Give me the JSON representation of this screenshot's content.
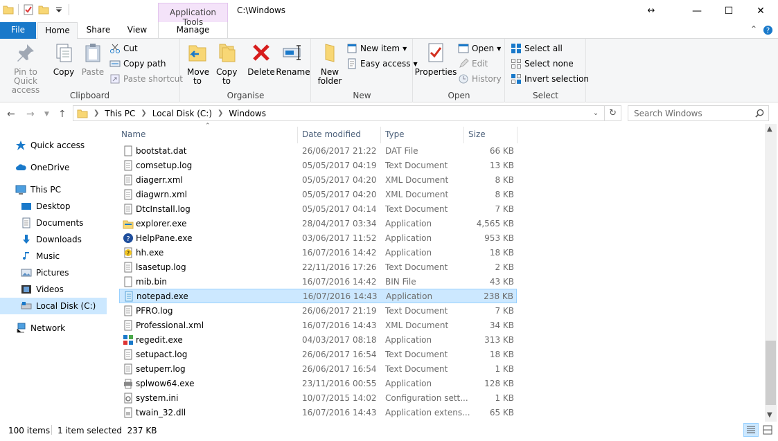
{
  "window": {
    "title": "C:\\Windows",
    "context_tab_group": "Application Tools",
    "minimize": "—",
    "maximize": "☐",
    "close": "✕",
    "resize_glyph": "↔"
  },
  "ribbon_tabs": {
    "file": "File",
    "home": "Home",
    "share": "Share",
    "view": "View",
    "manage": "Manage"
  },
  "ribbon": {
    "clipboard": {
      "label": "Clipboard",
      "pin_label": "Pin to Quick access",
      "copy_label": "Copy",
      "paste_label": "Paste",
      "cut_label": "Cut",
      "copy_path_label": "Copy path",
      "paste_shortcut_label": "Paste shortcut"
    },
    "organise": {
      "label": "Organise",
      "move_label": "Move to",
      "copy_to_label": "Copy to",
      "delete_label": "Delete",
      "rename_label": "Rename"
    },
    "new": {
      "label": "New",
      "new_folder_label": "New folder",
      "new_item_label": "New item",
      "easy_access_label": "Easy access"
    },
    "open": {
      "label": "Open",
      "properties_label": "Properties",
      "open_label": "Open",
      "edit_label": "Edit",
      "history_label": "History"
    },
    "select": {
      "label": "Select",
      "select_all_label": "Select all",
      "select_none_label": "Select none",
      "invert_label": "Invert selection"
    }
  },
  "address": {
    "crumbs": [
      "This PC",
      "Local Disk (C:)",
      "Windows"
    ],
    "search_placeholder": "Search Windows"
  },
  "nav_pane": {
    "items": [
      {
        "label": "Quick access",
        "icon": "star-icon"
      },
      {
        "label": "OneDrive",
        "icon": "cloud-icon"
      },
      {
        "label": "This PC",
        "icon": "computer-icon"
      },
      {
        "label": "Desktop",
        "icon": "desktop-icon"
      },
      {
        "label": "Documents",
        "icon": "documents-icon"
      },
      {
        "label": "Downloads",
        "icon": "download-icon"
      },
      {
        "label": "Music",
        "icon": "music-icon"
      },
      {
        "label": "Pictures",
        "icon": "pictures-icon"
      },
      {
        "label": "Videos",
        "icon": "videos-icon"
      },
      {
        "label": "Local Disk (C:)",
        "icon": "drive-icon"
      },
      {
        "label": "Network",
        "icon": "network-icon"
      }
    ]
  },
  "file_list": {
    "columns": {
      "name": "Name",
      "date": "Date modified",
      "type": "Type",
      "size": "Size"
    },
    "rows": [
      {
        "name": "bootstat.dat",
        "date": "26/06/2017 21:22",
        "type": "DAT File",
        "size": "66 KB",
        "icon": "file-icon"
      },
      {
        "name": "comsetup.log",
        "date": "05/05/2017 04:19",
        "type": "Text Document",
        "size": "13 KB",
        "icon": "text-file-icon"
      },
      {
        "name": "diagerr.xml",
        "date": "05/05/2017 04:20",
        "type": "XML Document",
        "size": "8 KB",
        "icon": "text-file-icon"
      },
      {
        "name": "diagwrn.xml",
        "date": "05/05/2017 04:20",
        "type": "XML Document",
        "size": "8 KB",
        "icon": "text-file-icon"
      },
      {
        "name": "DtcInstall.log",
        "date": "05/05/2017 04:14",
        "type": "Text Document",
        "size": "7 KB",
        "icon": "text-file-icon"
      },
      {
        "name": "explorer.exe",
        "date": "28/04/2017 03:34",
        "type": "Application",
        "size": "4,565 KB",
        "icon": "explorer-icon"
      },
      {
        "name": "HelpPane.exe",
        "date": "03/06/2017 11:52",
        "type": "Application",
        "size": "953 KB",
        "icon": "help-icon"
      },
      {
        "name": "hh.exe",
        "date": "16/07/2016 14:42",
        "type": "Application",
        "size": "18 KB",
        "icon": "help-file-icon"
      },
      {
        "name": "lsasetup.log",
        "date": "22/11/2016 17:26",
        "type": "Text Document",
        "size": "2 KB",
        "icon": "text-file-icon"
      },
      {
        "name": "mib.bin",
        "date": "16/07/2016 14:42",
        "type": "BIN File",
        "size": "43 KB",
        "icon": "file-icon"
      },
      {
        "name": "notepad.exe",
        "date": "16/07/2016 14:43",
        "type": "Application",
        "size": "238 KB",
        "icon": "notepad-icon",
        "selected": true
      },
      {
        "name": "PFRO.log",
        "date": "26/06/2017 21:19",
        "type": "Text Document",
        "size": "7 KB",
        "icon": "text-file-icon"
      },
      {
        "name": "Professional.xml",
        "date": "16/07/2016 14:43",
        "type": "XML Document",
        "size": "34 KB",
        "icon": "text-file-icon"
      },
      {
        "name": "regedit.exe",
        "date": "04/03/2017 08:18",
        "type": "Application",
        "size": "313 KB",
        "icon": "regedit-icon"
      },
      {
        "name": "setupact.log",
        "date": "26/06/2017 16:54",
        "type": "Text Document",
        "size": "18 KB",
        "icon": "text-file-icon"
      },
      {
        "name": "setuperr.log",
        "date": "26/06/2017 16:54",
        "type": "Text Document",
        "size": "1 KB",
        "icon": "text-file-icon"
      },
      {
        "name": "splwow64.exe",
        "date": "23/11/2016 00:55",
        "type": "Application",
        "size": "128 KB",
        "icon": "printer-icon"
      },
      {
        "name": "system.ini",
        "date": "10/07/2015 14:02",
        "type": "Configuration sett...",
        "size": "1 KB",
        "icon": "config-file-icon"
      },
      {
        "name": "twain_32.dll",
        "date": "16/07/2016 14:43",
        "type": "Application extens...",
        "size": "65 KB",
        "icon": "dll-file-icon"
      }
    ]
  },
  "status_bar": {
    "item_count": "100 items",
    "selection": "1 item selected  237 KB"
  },
  "colors": {
    "accent": "#1979ca",
    "selection": "#cce8ff",
    "context_tab": "#f4e3f9"
  }
}
